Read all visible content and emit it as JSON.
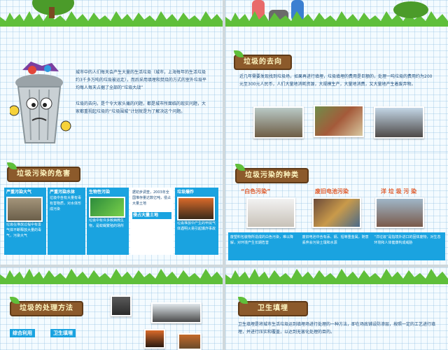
{
  "slide1": {
    "paragraph1": "城市中的人们每天会产生大量的生活垃圾（城市，上海每年的生活垃圾约3千多万吨的垃圾被运走），而后采用填埋和焚烧的方式的室外垃圾平均每人每天占据了全部的“垃圾大战”",
    "paragraph2": "垃圾的去向，是个令大家头痛的问题，都是城市所面临的现实问题，大家都重视起垃圾的“垃圾围城”计划就是为了解决这个问题。"
  },
  "slide2": {
    "title": "垃圾的去向",
    "paragraph": "近几年需要发现找到垃圾场，如果再进行填埋，垃圾填埋的费用是巨额的，处理一吨垃圾的费用约为200元至300元人民币，人们大量地消耗资源，大规模生产，大量地消费，又大量地产生着废弃物。"
  },
  "slide3": {
    "title": "垃圾污染的危害",
    "box1_title": "严重污染大气",
    "box1_text": "垃圾在堆放过程中有害气体不断释放大量的毒气，污染大气",
    "box2_title": "严重污染水体",
    "box2_text": "垃圾中含有大量有毒有害物质，对水体形成污染",
    "box3_title": "生物性污染",
    "box3_text": "垃圾中有许多致病微生物，是蚊蝇繁殖的场所",
    "box4_title": "侵占大量土地",
    "box4_text": "据初步调查，2003年全国堆存量达数亿吨，侵占大量土地",
    "box5_title": "垃圾爆炸",
    "box5_text": "垃圾堆放中产生的甲烷气体遇明火易引起爆炸事故"
  },
  "slide4": {
    "title": "垃圾污染的种类",
    "type1": "“白色污染”",
    "type2": "废旧电池污染",
    "type3": "洋 垃 圾 污 染",
    "text1": "废塑料包装物所造成的白色污染，难以降解，对环境产生长期危害",
    "text2": "废旧电池中含有汞、镉、铅等重金属，随意丢弃会污染土壤和水源",
    "text3": "“洋垃圾”是指境外进口的固体废物，对生态环境和人体健康构成威胁"
  },
  "slide5": {
    "title": "垃圾的处理方法",
    "method1": "综合利用",
    "method2": "卫生填埋"
  },
  "slide6": {
    "title": "卫生填埋",
    "paragraph": "卫生填埋是将城市生活垃圾运到填埋场进行处理的一种方法，即在场底铺设防渗层，按照一定的工艺进行填埋，并进行压实和覆盖，以达到无害化处理的目的。"
  },
  "colors": {
    "accent_blue": "#1aa3e0",
    "tag_brown": "#8c5a2b",
    "grass_green": "#5fbf3a",
    "text_navy": "#1b4b7a"
  }
}
